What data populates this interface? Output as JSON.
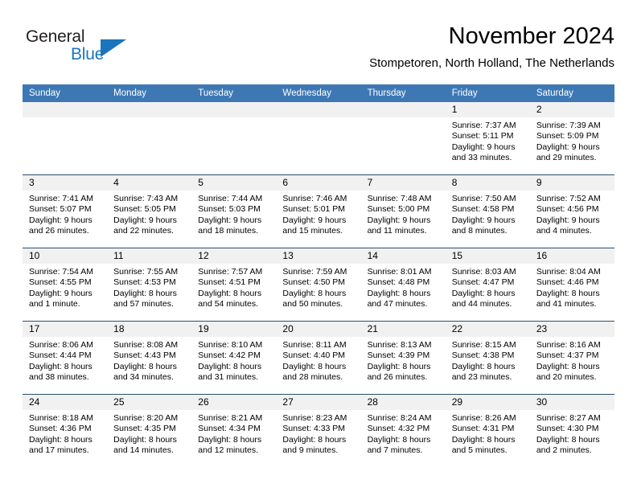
{
  "brand": {
    "name_top": "General",
    "name_bottom": "Blue",
    "accent_color": "#1b75bb"
  },
  "header": {
    "title": "November 2024",
    "subtitle": "Stompetoren, North Holland, The Netherlands"
  },
  "theme": {
    "header_row_bg": "#3d78b4",
    "daynum_band_bg": "#f1f1f1",
    "row_separator": "#2a4e72",
    "page_bg": "#ffffff"
  },
  "columns": [
    "Sunday",
    "Monday",
    "Tuesday",
    "Wednesday",
    "Thursday",
    "Friday",
    "Saturday"
  ],
  "weeks": [
    [
      {
        "day": "",
        "sunrise": "",
        "sunset": "",
        "daylight_1": "",
        "daylight_2": "",
        "empty": true
      },
      {
        "day": "",
        "sunrise": "",
        "sunset": "",
        "daylight_1": "",
        "daylight_2": "",
        "empty": true
      },
      {
        "day": "",
        "sunrise": "",
        "sunset": "",
        "daylight_1": "",
        "daylight_2": "",
        "empty": true
      },
      {
        "day": "",
        "sunrise": "",
        "sunset": "",
        "daylight_1": "",
        "daylight_2": "",
        "empty": true
      },
      {
        "day": "",
        "sunrise": "",
        "sunset": "",
        "daylight_1": "",
        "daylight_2": "",
        "empty": true
      },
      {
        "day": "1",
        "sunrise": "Sunrise: 7:37 AM",
        "sunset": "Sunset: 5:11 PM",
        "daylight_1": "Daylight: 9 hours",
        "daylight_2": "and 33 minutes."
      },
      {
        "day": "2",
        "sunrise": "Sunrise: 7:39 AM",
        "sunset": "Sunset: 5:09 PM",
        "daylight_1": "Daylight: 9 hours",
        "daylight_2": "and 29 minutes."
      }
    ],
    [
      {
        "day": "3",
        "sunrise": "Sunrise: 7:41 AM",
        "sunset": "Sunset: 5:07 PM",
        "daylight_1": "Daylight: 9 hours",
        "daylight_2": "and 26 minutes."
      },
      {
        "day": "4",
        "sunrise": "Sunrise: 7:43 AM",
        "sunset": "Sunset: 5:05 PM",
        "daylight_1": "Daylight: 9 hours",
        "daylight_2": "and 22 minutes."
      },
      {
        "day": "5",
        "sunrise": "Sunrise: 7:44 AM",
        "sunset": "Sunset: 5:03 PM",
        "daylight_1": "Daylight: 9 hours",
        "daylight_2": "and 18 minutes."
      },
      {
        "day": "6",
        "sunrise": "Sunrise: 7:46 AM",
        "sunset": "Sunset: 5:01 PM",
        "daylight_1": "Daylight: 9 hours",
        "daylight_2": "and 15 minutes."
      },
      {
        "day": "7",
        "sunrise": "Sunrise: 7:48 AM",
        "sunset": "Sunset: 5:00 PM",
        "daylight_1": "Daylight: 9 hours",
        "daylight_2": "and 11 minutes."
      },
      {
        "day": "8",
        "sunrise": "Sunrise: 7:50 AM",
        "sunset": "Sunset: 4:58 PM",
        "daylight_1": "Daylight: 9 hours",
        "daylight_2": "and 8 minutes."
      },
      {
        "day": "9",
        "sunrise": "Sunrise: 7:52 AM",
        "sunset": "Sunset: 4:56 PM",
        "daylight_1": "Daylight: 9 hours",
        "daylight_2": "and 4 minutes."
      }
    ],
    [
      {
        "day": "10",
        "sunrise": "Sunrise: 7:54 AM",
        "sunset": "Sunset: 4:55 PM",
        "daylight_1": "Daylight: 9 hours",
        "daylight_2": "and 1 minute."
      },
      {
        "day": "11",
        "sunrise": "Sunrise: 7:55 AM",
        "sunset": "Sunset: 4:53 PM",
        "daylight_1": "Daylight: 8 hours",
        "daylight_2": "and 57 minutes."
      },
      {
        "day": "12",
        "sunrise": "Sunrise: 7:57 AM",
        "sunset": "Sunset: 4:51 PM",
        "daylight_1": "Daylight: 8 hours",
        "daylight_2": "and 54 minutes."
      },
      {
        "day": "13",
        "sunrise": "Sunrise: 7:59 AM",
        "sunset": "Sunset: 4:50 PM",
        "daylight_1": "Daylight: 8 hours",
        "daylight_2": "and 50 minutes."
      },
      {
        "day": "14",
        "sunrise": "Sunrise: 8:01 AM",
        "sunset": "Sunset: 4:48 PM",
        "daylight_1": "Daylight: 8 hours",
        "daylight_2": "and 47 minutes."
      },
      {
        "day": "15",
        "sunrise": "Sunrise: 8:03 AM",
        "sunset": "Sunset: 4:47 PM",
        "daylight_1": "Daylight: 8 hours",
        "daylight_2": "and 44 minutes."
      },
      {
        "day": "16",
        "sunrise": "Sunrise: 8:04 AM",
        "sunset": "Sunset: 4:46 PM",
        "daylight_1": "Daylight: 8 hours",
        "daylight_2": "and 41 minutes."
      }
    ],
    [
      {
        "day": "17",
        "sunrise": "Sunrise: 8:06 AM",
        "sunset": "Sunset: 4:44 PM",
        "daylight_1": "Daylight: 8 hours",
        "daylight_2": "and 38 minutes."
      },
      {
        "day": "18",
        "sunrise": "Sunrise: 8:08 AM",
        "sunset": "Sunset: 4:43 PM",
        "daylight_1": "Daylight: 8 hours",
        "daylight_2": "and 34 minutes."
      },
      {
        "day": "19",
        "sunrise": "Sunrise: 8:10 AM",
        "sunset": "Sunset: 4:42 PM",
        "daylight_1": "Daylight: 8 hours",
        "daylight_2": "and 31 minutes."
      },
      {
        "day": "20",
        "sunrise": "Sunrise: 8:11 AM",
        "sunset": "Sunset: 4:40 PM",
        "daylight_1": "Daylight: 8 hours",
        "daylight_2": "and 28 minutes."
      },
      {
        "day": "21",
        "sunrise": "Sunrise: 8:13 AM",
        "sunset": "Sunset: 4:39 PM",
        "daylight_1": "Daylight: 8 hours",
        "daylight_2": "and 26 minutes."
      },
      {
        "day": "22",
        "sunrise": "Sunrise: 8:15 AM",
        "sunset": "Sunset: 4:38 PM",
        "daylight_1": "Daylight: 8 hours",
        "daylight_2": "and 23 minutes."
      },
      {
        "day": "23",
        "sunrise": "Sunrise: 8:16 AM",
        "sunset": "Sunset: 4:37 PM",
        "daylight_1": "Daylight: 8 hours",
        "daylight_2": "and 20 minutes."
      }
    ],
    [
      {
        "day": "24",
        "sunrise": "Sunrise: 8:18 AM",
        "sunset": "Sunset: 4:36 PM",
        "daylight_1": "Daylight: 8 hours",
        "daylight_2": "and 17 minutes."
      },
      {
        "day": "25",
        "sunrise": "Sunrise: 8:20 AM",
        "sunset": "Sunset: 4:35 PM",
        "daylight_1": "Daylight: 8 hours",
        "daylight_2": "and 14 minutes."
      },
      {
        "day": "26",
        "sunrise": "Sunrise: 8:21 AM",
        "sunset": "Sunset: 4:34 PM",
        "daylight_1": "Daylight: 8 hours",
        "daylight_2": "and 12 minutes."
      },
      {
        "day": "27",
        "sunrise": "Sunrise: 8:23 AM",
        "sunset": "Sunset: 4:33 PM",
        "daylight_1": "Daylight: 8 hours",
        "daylight_2": "and 9 minutes."
      },
      {
        "day": "28",
        "sunrise": "Sunrise: 8:24 AM",
        "sunset": "Sunset: 4:32 PM",
        "daylight_1": "Daylight: 8 hours",
        "daylight_2": "and 7 minutes."
      },
      {
        "day": "29",
        "sunrise": "Sunrise: 8:26 AM",
        "sunset": "Sunset: 4:31 PM",
        "daylight_1": "Daylight: 8 hours",
        "daylight_2": "and 5 minutes."
      },
      {
        "day": "30",
        "sunrise": "Sunrise: 8:27 AM",
        "sunset": "Sunset: 4:30 PM",
        "daylight_1": "Daylight: 8 hours",
        "daylight_2": "and 2 minutes."
      }
    ]
  ]
}
